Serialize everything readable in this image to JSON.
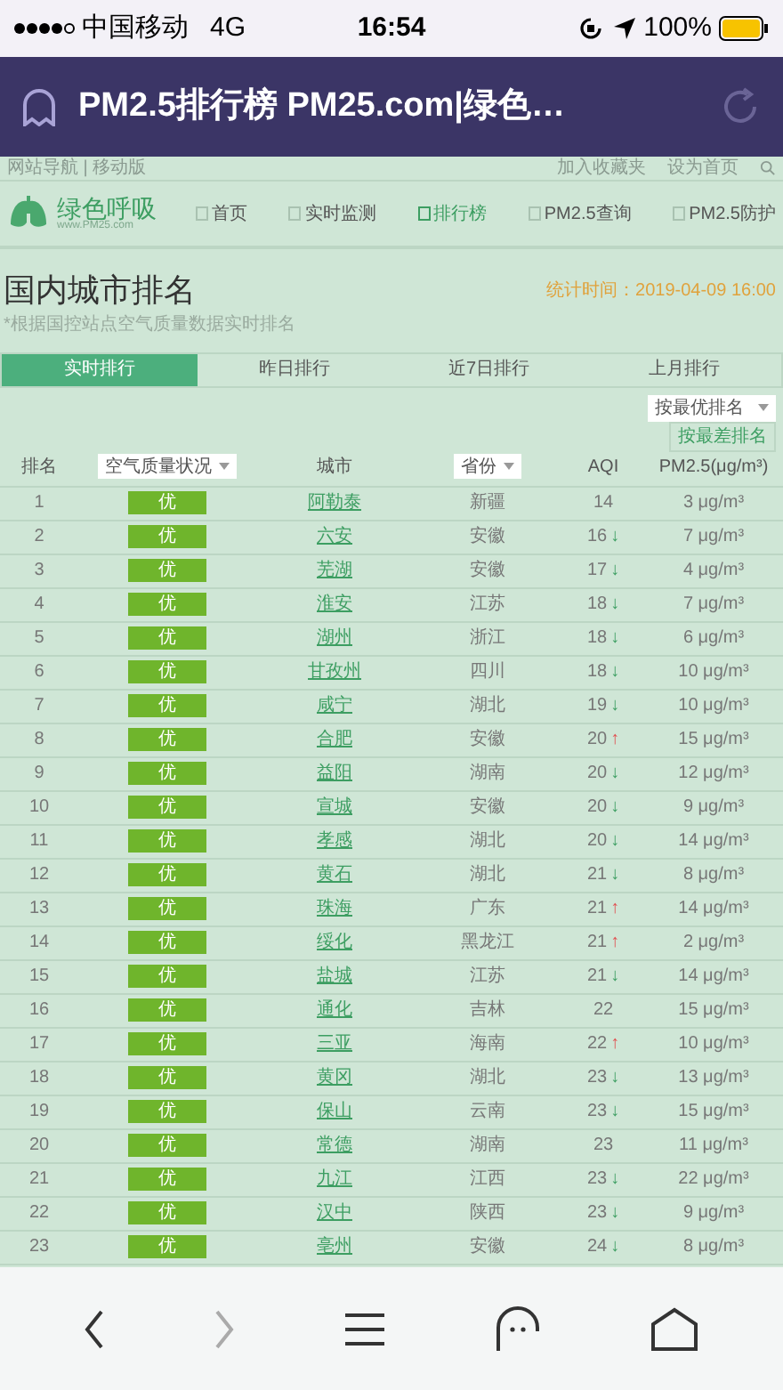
{
  "status_bar": {
    "carrier": "中国移动",
    "network": "4G",
    "time": "16:54",
    "battery": "100%"
  },
  "browser": {
    "title": "PM2.5排行榜 PM25.com|绿色…"
  },
  "site": {
    "top_links_left": "网站导航 | 移动版",
    "top_links_right": [
      "加入收藏夹",
      "设为首页"
    ],
    "logo": "绿色呼吸",
    "logo_sub": "www.PM25.com",
    "nav": [
      {
        "label": "首页",
        "selected": false
      },
      {
        "label": "实时监测",
        "selected": false
      },
      {
        "label": "排行榜",
        "selected": true
      },
      {
        "label": "PM2.5查询",
        "selected": false
      },
      {
        "label": "PM2.5防护",
        "selected": false
      }
    ]
  },
  "heading": {
    "title": "国内城市排名",
    "subtitle": "*根据国控站点空气质量数据实时排名",
    "time": "统计时间：2019-04-09 16:00"
  },
  "tabs": [
    {
      "label": "实时排行",
      "selected": true
    },
    {
      "label": "昨日排行",
      "selected": false
    },
    {
      "label": "近7日排行",
      "selected": false
    },
    {
      "label": "上月排行",
      "selected": false
    }
  ],
  "sort": {
    "value": "按最优排名",
    "option": "按最差排名"
  },
  "table": {
    "columns": [
      "排名",
      "空气质量状况",
      "城市",
      "省份",
      "AQI",
      "PM2.5(μg/m³)"
    ],
    "rows": [
      {
        "rank": "1",
        "quality": "优",
        "city": "阿勒泰",
        "province": "新疆",
        "aqi": "14",
        "pm25": "3 μg/m³"
      },
      {
        "rank": "2",
        "quality": "优",
        "city": "六安",
        "province": "安徽",
        "aqi": "16",
        "arrow": "↓",
        "rising": false,
        "pm25": "7 μg/m³"
      },
      {
        "rank": "3",
        "quality": "优",
        "city": "芜湖",
        "province": "安徽",
        "aqi": "17",
        "arrow": "↓",
        "rising": false,
        "pm25": "4 μg/m³"
      },
      {
        "rank": "4",
        "quality": "优",
        "city": "淮安",
        "province": "江苏",
        "aqi": "18",
        "arrow": "↓",
        "rising": false,
        "pm25": "7 μg/m³"
      },
      {
        "rank": "5",
        "quality": "优",
        "city": "湖州",
        "province": "浙江",
        "aqi": "18",
        "arrow": "↓",
        "rising": false,
        "pm25": "6 μg/m³"
      },
      {
        "rank": "6",
        "quality": "优",
        "city": "甘孜州",
        "province": "四川",
        "aqi": "18",
        "arrow": "↓",
        "rising": false,
        "pm25": "10 μg/m³"
      },
      {
        "rank": "7",
        "quality": "优",
        "city": "咸宁",
        "province": "湖北",
        "aqi": "19",
        "arrow": "↓",
        "rising": false,
        "pm25": "10 μg/m³"
      },
      {
        "rank": "8",
        "quality": "优",
        "city": "合肥",
        "province": "安徽",
        "aqi": "20",
        "arrow": "↑",
        "rising": true,
        "pm25": "15 μg/m³"
      },
      {
        "rank": "9",
        "quality": "优",
        "city": "益阳",
        "province": "湖南",
        "aqi": "20",
        "arrow": "↓",
        "rising": false,
        "pm25": "12 μg/m³"
      },
      {
        "rank": "10",
        "quality": "优",
        "city": "宣城",
        "province": "安徽",
        "aqi": "20",
        "arrow": "↓",
        "rising": false,
        "pm25": "9 μg/m³"
      },
      {
        "rank": "11",
        "quality": "优",
        "city": "孝感",
        "province": "湖北",
        "aqi": "20",
        "arrow": "↓",
        "rising": false,
        "pm25": "14 μg/m³"
      },
      {
        "rank": "12",
        "quality": "优",
        "city": "黄石",
        "province": "湖北",
        "aqi": "21",
        "arrow": "↓",
        "rising": false,
        "pm25": "8 μg/m³"
      },
      {
        "rank": "13",
        "quality": "优",
        "city": "珠海",
        "province": "广东",
        "aqi": "21",
        "arrow": "↑",
        "rising": true,
        "pm25": "14 μg/m³"
      },
      {
        "rank": "14",
        "quality": "优",
        "city": "绥化",
        "province": "黑龙江",
        "aqi": "21",
        "arrow": "↑",
        "rising": true,
        "pm25": "2 μg/m³"
      },
      {
        "rank": "15",
        "quality": "优",
        "city": "盐城",
        "province": "江苏",
        "aqi": "21",
        "arrow": "↓",
        "rising": false,
        "pm25": "14 μg/m³"
      },
      {
        "rank": "16",
        "quality": "优",
        "city": "通化",
        "province": "吉林",
        "aqi": "22",
        "pm25": "15 μg/m³"
      },
      {
        "rank": "17",
        "quality": "优",
        "city": "三亚",
        "province": "海南",
        "aqi": "22",
        "arrow": "↑",
        "rising": true,
        "pm25": "10 μg/m³"
      },
      {
        "rank": "18",
        "quality": "优",
        "city": "黄冈",
        "province": "湖北",
        "aqi": "23",
        "arrow": "↓",
        "rising": false,
        "pm25": "13 μg/m³"
      },
      {
        "rank": "19",
        "quality": "优",
        "city": "保山",
        "province": "云南",
        "aqi": "23",
        "arrow": "↓",
        "rising": false,
        "pm25": "15 μg/m³"
      },
      {
        "rank": "20",
        "quality": "优",
        "city": "常德",
        "province": "湖南",
        "aqi": "23",
        "pm25": "11 μg/m³"
      },
      {
        "rank": "21",
        "quality": "优",
        "city": "九江",
        "province": "江西",
        "aqi": "23",
        "arrow": "↓",
        "rising": false,
        "pm25": "22 μg/m³"
      },
      {
        "rank": "22",
        "quality": "优",
        "city": "汉中",
        "province": "陕西",
        "aqi": "23",
        "arrow": "↓",
        "rising": false,
        "pm25": "9 μg/m³"
      },
      {
        "rank": "23",
        "quality": "优",
        "city": "亳州",
        "province": "安徽",
        "aqi": "24",
        "arrow": "↓",
        "rising": false,
        "pm25": "8 μg/m³"
      }
    ]
  }
}
